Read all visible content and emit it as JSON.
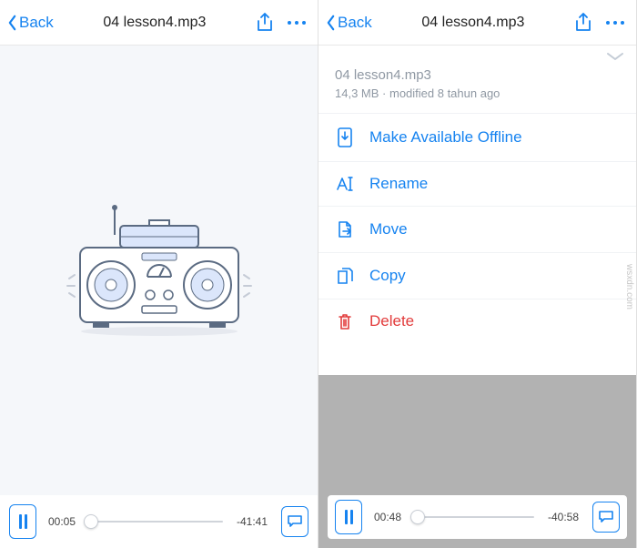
{
  "colors": {
    "accent": "#1683f0",
    "danger": "#e23b3b"
  },
  "watermark": "wsxdn.com",
  "left": {
    "back_label": "Back",
    "title": "04 lesson4.mp3",
    "player": {
      "elapsed": "00:05",
      "remaining": "-41:41",
      "progress_pct": 3
    }
  },
  "right": {
    "back_label": "Back",
    "title": "04 lesson4.mp3",
    "file": {
      "name": "04 lesson4.mp3",
      "size": "14,3 MB",
      "modified": "modified 8 tahun ago"
    },
    "menu": {
      "offline": "Make Available Offline",
      "rename": "Rename",
      "move": "Move",
      "copy": "Copy",
      "delete": "Delete"
    },
    "player": {
      "elapsed": "00:48",
      "remaining": "-40:58",
      "progress_pct": 4
    }
  }
}
